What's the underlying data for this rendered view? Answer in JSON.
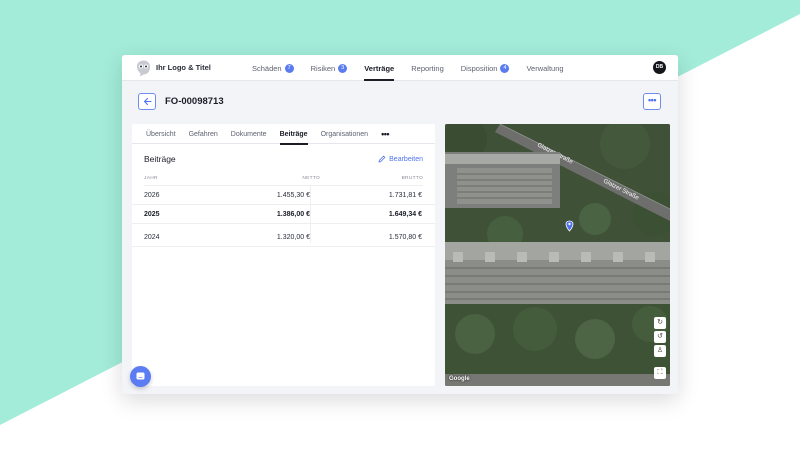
{
  "header": {
    "logo_text": "Ihr Logo & Titel",
    "nav": [
      {
        "label": "Schäden",
        "badge": "7"
      },
      {
        "label": "Risiken",
        "badge": "3"
      },
      {
        "label": "Verträge",
        "badge": ""
      },
      {
        "label": "Reporting",
        "badge": ""
      },
      {
        "label": "Disposition",
        "badge": "4"
      },
      {
        "label": "Verwaltung",
        "badge": ""
      }
    ],
    "active_nav": "Verträge",
    "avatar_initials": "DB"
  },
  "page": {
    "back_icon": "arrow-left-icon",
    "record_id": "FO-00098713",
    "more_icon": "more-horizontal-icon"
  },
  "tabs": {
    "items": [
      "Übersicht",
      "Gefahren",
      "Dokumente",
      "Beiträge",
      "Organisationen"
    ],
    "active": "Beiträge",
    "overflow_label": "•••"
  },
  "contributions": {
    "title": "Beiträge",
    "edit_label": "Bearbeiten",
    "columns": [
      "JAHR",
      "NETTO",
      "BRUTTO"
    ],
    "rows": [
      {
        "jahr": "2026",
        "netto": "1.455,30 €",
        "brutto": "1.731,81 €",
        "bold": false
      },
      {
        "jahr": "2025",
        "netto": "1.386,00 €",
        "brutto": "1.649,34 €",
        "bold": true
      },
      {
        "jahr": "2024",
        "netto": "1.320,00 €",
        "brutto": "1.570,80 €",
        "bold": false
      }
    ]
  },
  "map": {
    "street_labels": [
      "Glatzer Straße",
      "Glatzer Straße"
    ],
    "attribution": "Google",
    "controls": [
      "rotate-cw-icon",
      "rotate-ccw-icon",
      "pegman-icon",
      "fullscreen-icon"
    ]
  },
  "colors": {
    "accent": "#5b7cf2",
    "mint_background": "#a3ecd9",
    "app_background": "#f3f4f8"
  }
}
